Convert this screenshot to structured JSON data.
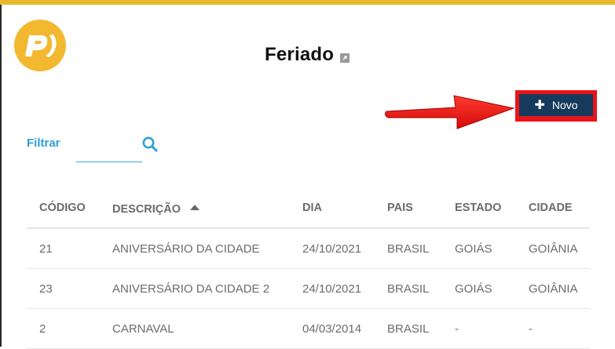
{
  "page": {
    "title": "Feriado"
  },
  "colors": {
    "accent": "#2ea0d6",
    "brand": "#f2b830",
    "button_bg": "#163a5c",
    "highlight": "#e8141b"
  },
  "toolbar": {
    "new_label": "Novo"
  },
  "filter": {
    "label": "Filtrar",
    "value": ""
  },
  "table": {
    "columns": [
      "CÓDIGO",
      "DESCRIÇÃO",
      "DIA",
      "PAIS",
      "ESTADO",
      "CIDADE"
    ],
    "rows": [
      [
        "21",
        "ANIVERSÁRIO DA CIDADE",
        "24/10/2021",
        "BRASIL",
        "GOIÁS",
        "GOIÂNIA"
      ],
      [
        "23",
        "ANIVERSÁRIO DA CIDADE 2",
        "24/10/2021",
        "BRASIL",
        "GOIÁS",
        "GOIÂNIA"
      ],
      [
        "2",
        "CARNAVAL",
        "04/03/2014",
        "BRASIL",
        "-",
        "-"
      ]
    ]
  }
}
